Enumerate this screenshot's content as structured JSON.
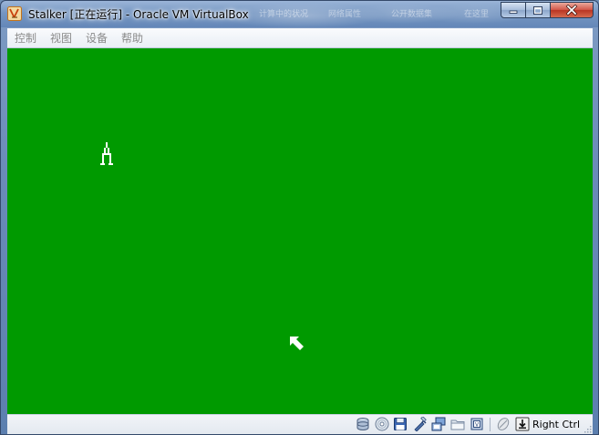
{
  "window": {
    "title": "Stalker [正在运行] - Oracle VM VirtualBox",
    "taskbar_ghost": [
      "计算中的状况",
      "网络属性",
      "公开数据集",
      "在这里"
    ]
  },
  "menubar": {
    "items": [
      "控制",
      "视图",
      "设备",
      "帮助"
    ]
  },
  "guest_screen": {
    "background_color": "#009a00",
    "glyph_color": "#ffffff"
  },
  "statusbar": {
    "icons": [
      "hard-disk-icon",
      "optical-drive-icon",
      "floppy-drive-icon",
      "usb-icon",
      "network-icon",
      "shared-folders-icon",
      "virtualization-icon",
      "mouse-integration-icon",
      "keyboard-capture-icon"
    ],
    "host_key": "Right Ctrl"
  }
}
